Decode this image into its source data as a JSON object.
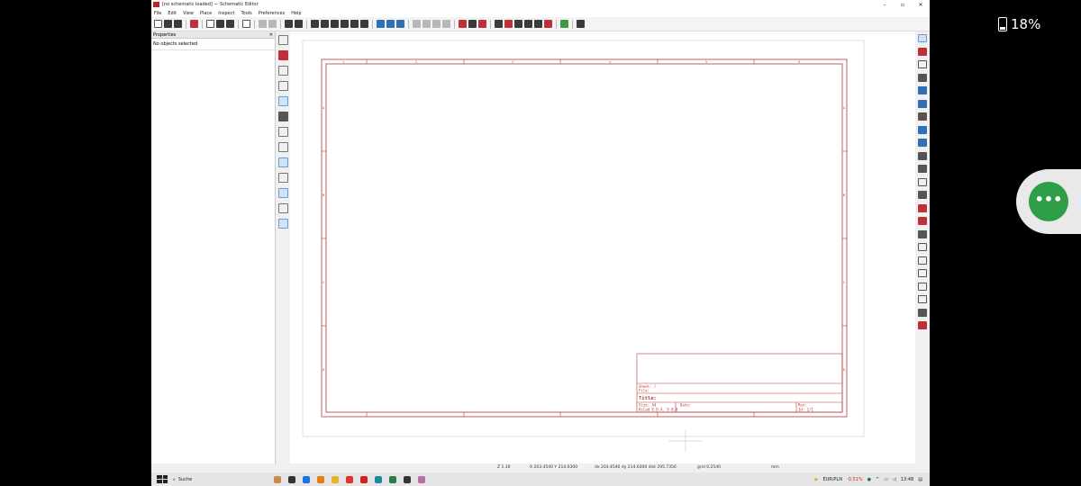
{
  "phone": {
    "battery": "18%"
  },
  "window": {
    "title": "[no schematic loaded] — Schematic Editor",
    "controls": {
      "minimize": "–",
      "maximize": "▫",
      "close": "✕"
    }
  },
  "menu": [
    "File",
    "Edit",
    "View",
    "Place",
    "Inspect",
    "Tools",
    "Preferences",
    "Help"
  ],
  "properties": {
    "header": "Properties",
    "close": "✕",
    "empty": "No objects selected"
  },
  "sheet": {
    "cols_top": [
      "1",
      "2",
      "3",
      "4",
      "5",
      "6"
    ],
    "rows_side": [
      "A",
      "B",
      "C",
      "D"
    ],
    "title_block": {
      "sheet": "Sheet: /",
      "file": "File:",
      "title": "Title:",
      "size": "Size: A4",
      "date": "Date:",
      "rev": "Rev:",
      "kicad": "KiCad E.D.A. 9.0.0",
      "id": "Id: 1/1"
    }
  },
  "status": {
    "zoom": "Z 1.30",
    "cursor": "X 203.4540  Y 214.6300",
    "delta": "dx 203.4540  dy 214.6300  dist 295.7356",
    "grid": "grid 0.2540",
    "units": "mm"
  },
  "taskbar": {
    "search": "Suche",
    "ticker_label": "EUR/PLN",
    "ticker_value": "-0,51%",
    "time": "13:48"
  }
}
